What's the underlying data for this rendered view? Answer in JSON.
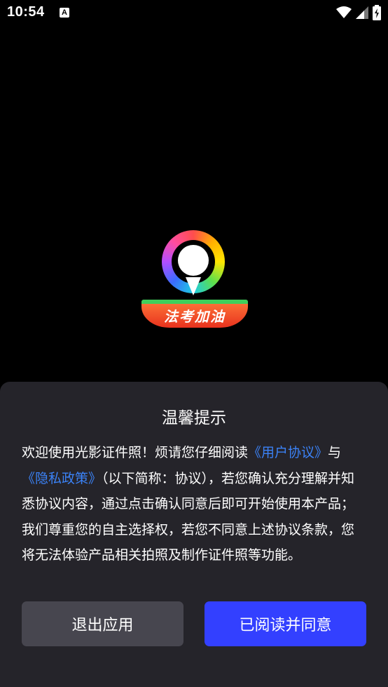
{
  "status_bar": {
    "time": "10:54",
    "notification_icon_label": "A",
    "icons": [
      "wifi-icon",
      "signal-icon",
      "battery-charging-icon"
    ]
  },
  "splash": {
    "logo_text": "法考加油",
    "logo_colors": {
      "banner": "#e8321e",
      "banner_stripe": "#3fcf5b"
    }
  },
  "dialog": {
    "title": "温馨提示",
    "body_intro": "欢迎使用光影证件照！烦请您仔细阅读",
    "user_agreement_link": "《用户协议》",
    "conjunction": "与",
    "privacy_policy_link": "《隐私政策》",
    "body_rest": "（以下简称：协议），若您确认充分理解并知悉协议内容，通过点击确认同意后即可开始使用本产品；我们尊重您的自主选择权，若您不同意上述协议条款，您将无法体验产品相关拍照及制作证件照等功能。",
    "exit_button": "退出应用",
    "agree_button": "已阅读并同意"
  },
  "colors": {
    "background": "#000000",
    "dialog_background": "#25242a",
    "link": "#3b82f6",
    "primary_button": "#3340ff",
    "secondary_button": "#47464f"
  }
}
